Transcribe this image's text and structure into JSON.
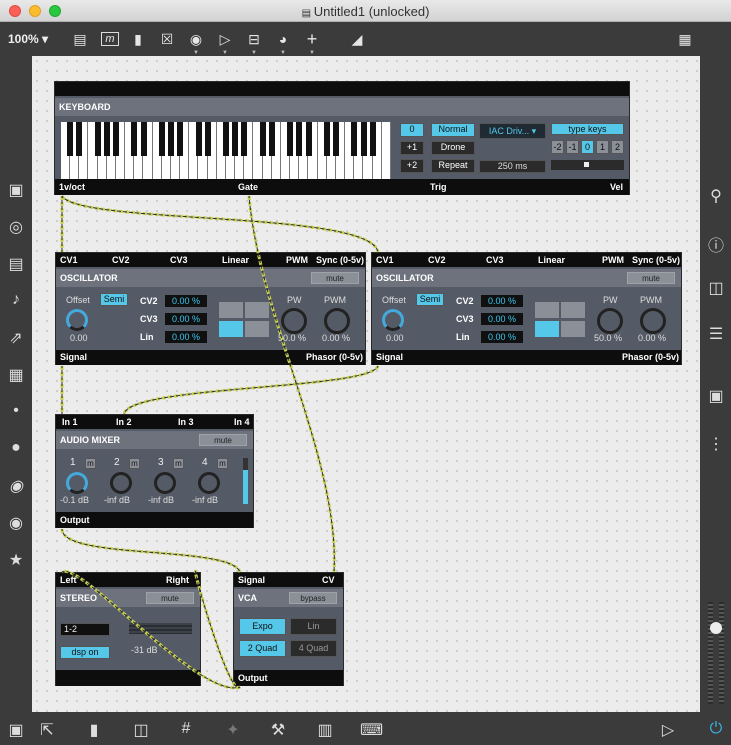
{
  "window": {
    "title": "Untitled1 (unlocked)",
    "zoom": "100% ▾"
  },
  "colors": {
    "accent": "#55c8ea",
    "cable": "#c7cf52"
  },
  "keyboard": {
    "bar_title": "",
    "header": "KEYBOARD",
    "octave_0": "0",
    "octave_up": "+1",
    "octave_up2": "+2",
    "mode_normal": "Normal",
    "mode_drone": "Drone",
    "mode_repeat": "Repeat",
    "midi_device": "IAC Driv... ▾",
    "repeat_time": "250 ms",
    "type_keys": "type keys",
    "octave_buttons": [
      "-2",
      "-1",
      "0",
      "1",
      "2"
    ],
    "outputs": [
      "1v/oct",
      "Gate",
      "Trig",
      "Vel"
    ]
  },
  "oscillators": [
    {
      "inputs": [
        "CV1",
        "CV2",
        "CV3",
        "Linear",
        "PWM",
        "Sync (0-5v)"
      ],
      "header": "OSCILLATOR",
      "mute": "mute",
      "offset_label": "Offset",
      "semi": "Semi",
      "offset_value": "0.00",
      "cv2_label": "CV2",
      "cv2": "0.00 %",
      "cv3_label": "CV3",
      "cv3": "0.00 %",
      "lin_label": "Lin",
      "lin": "0.00 %",
      "pw_label": "PW",
      "pw": "50.0 %",
      "pwm_label": "PWM",
      "pwm": "0.00 %",
      "out_signal": "Signal",
      "out_phasor": "Phasor (0-5v)"
    },
    {
      "inputs": [
        "CV1",
        "CV2",
        "CV3",
        "Linear",
        "PWM",
        "Sync (0-5v)"
      ],
      "header": "OSCILLATOR",
      "mute": "mute",
      "offset_label": "Offset",
      "semi": "Semi",
      "offset_value": "0.00",
      "cv2_label": "CV2",
      "cv2": "0.00 %",
      "cv3_label": "CV3",
      "cv3": "0.00 %",
      "lin_label": "Lin",
      "lin": "0.00 %",
      "pw_label": "PW",
      "pw": "50.0 %",
      "pwm_label": "PWM",
      "pwm": "0.00 %",
      "out_signal": "Signal",
      "out_phasor": "Phasor (0-5v)"
    }
  ],
  "mixer": {
    "inputs": [
      "In 1",
      "In 2",
      "In 3",
      "In 4"
    ],
    "header": "AUDIO MIXER",
    "mute": "mute",
    "channels": [
      {
        "num": "1",
        "m": "m",
        "value": "-0.1 dB"
      },
      {
        "num": "2",
        "m": "m",
        "value": "-inf dB"
      },
      {
        "num": "3",
        "m": "m",
        "value": "-inf dB"
      },
      {
        "num": "4",
        "m": "m",
        "value": "-inf dB"
      }
    ],
    "output": "Output"
  },
  "stereo": {
    "inputs": [
      "Left",
      "Right"
    ],
    "header": "STEREO",
    "mute": "mute",
    "channels": "1-2",
    "dsp": "dsp on",
    "level": "-31 dB"
  },
  "vca": {
    "inputs": [
      "Signal",
      "CV"
    ],
    "header": "VCA",
    "bypass": "bypass",
    "expo": "Expo",
    "lin": "Lin",
    "quad2": "2 Quad",
    "quad4": "4 Quad",
    "output": "Output"
  }
}
